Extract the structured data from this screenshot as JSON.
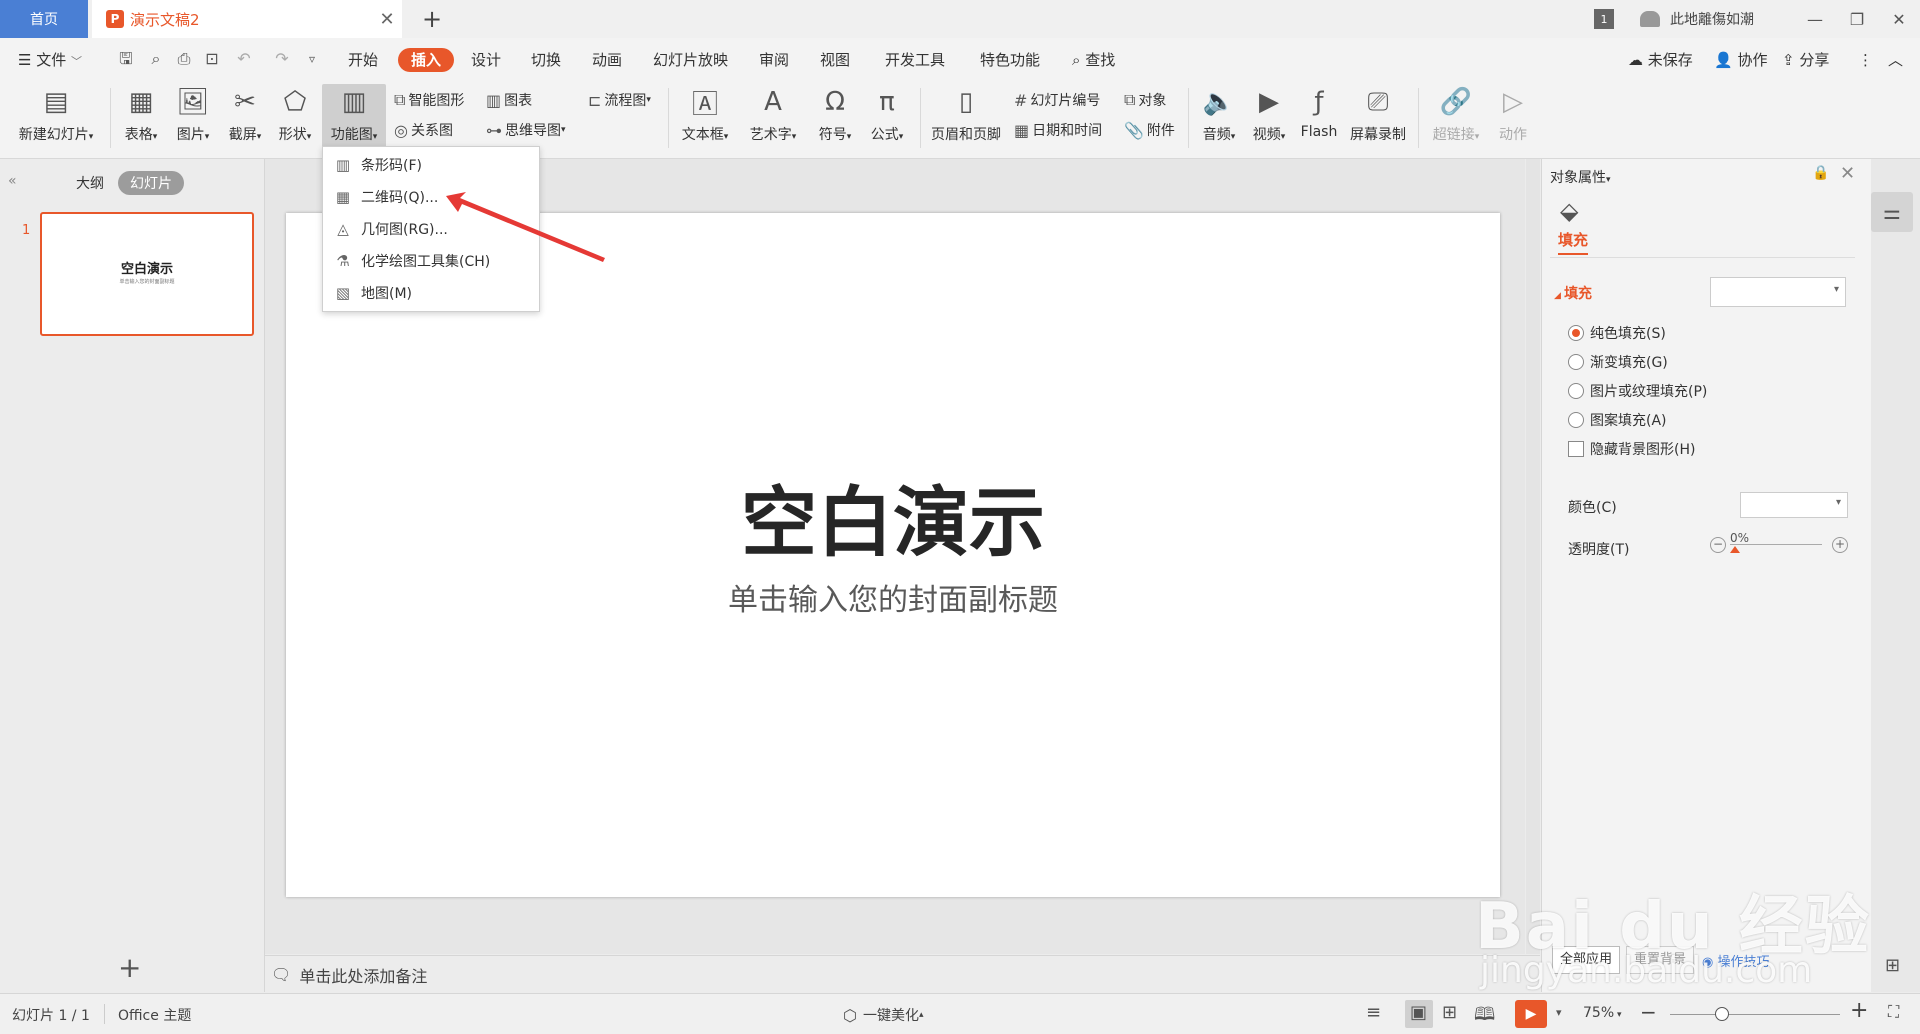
{
  "window": {
    "home_tab": "首页",
    "doc_tab": "演示文稿2",
    "doc_icon_glyph": "P",
    "new_tab_glyph": "+",
    "user_badge": "1",
    "user_name": "此地離傷如潮"
  },
  "menu": {
    "file": "文件",
    "tabs": [
      "开始",
      "插入",
      "设计",
      "切换",
      "动画",
      "幻灯片放映",
      "审阅",
      "视图",
      "开发工具",
      "特色功能"
    ],
    "search": "查找",
    "unsaved": "未保存",
    "collab": "协作",
    "share": "分享"
  },
  "ribbon": {
    "new_slide": "新建幻灯片",
    "table": "表格",
    "picture": "图片",
    "screenshot": "截屏",
    "shape": "形状",
    "function_chart": "功能图",
    "smart_graphic": "智能图形",
    "chart": "图表",
    "relation_chart": "关系图",
    "mind_map": "思维导图",
    "flowchart": "流程图",
    "textbox": "文本框",
    "art_text": "艺术字",
    "symbol": "符号",
    "formula": "公式",
    "header_footer": "页眉和页脚",
    "slide_number": "幻灯片编号",
    "object": "对象",
    "datetime": "日期和时间",
    "attachment": "附件",
    "audio": "音频",
    "video": "视频",
    "flash": "Flash",
    "screen_record": "屏幕录制",
    "hyperlink": "超链接",
    "action": "动作"
  },
  "dropdown": {
    "items": [
      {
        "label": "条形码(F)",
        "icon": "barcode-icon"
      },
      {
        "label": "二维码(Q)...",
        "icon": "qrcode-icon"
      },
      {
        "label": "几何图(RG)...",
        "icon": "geometry-icon"
      },
      {
        "label": "化学绘图工具集(CH)",
        "icon": "flask-icon"
      },
      {
        "label": "地图(M)",
        "icon": "map-icon"
      }
    ]
  },
  "left_panel": {
    "tab_outline": "大纲",
    "tab_slides": "幻灯片",
    "slide_number": "1",
    "thumb_title": "空白演示",
    "thumb_subtitle": "单击输入您的封面副标题"
  },
  "slide": {
    "title": "空白演示",
    "subtitle": "单击输入您的封面副标题"
  },
  "notes": {
    "placeholder": "单击此处添加备注"
  },
  "right_panel": {
    "title": "对象属性",
    "fill_tab": "填充",
    "fill_section": "填充",
    "options": [
      {
        "label": "纯色填充(S)",
        "type": "radio",
        "checked": true
      },
      {
        "label": "渐变填充(G)",
        "type": "radio",
        "checked": false
      },
      {
        "label": "图片或纹理填充(P)",
        "type": "radio",
        "checked": false
      },
      {
        "label": "图案填充(A)",
        "type": "radio",
        "checked": false
      },
      {
        "label": "隐藏背景图形(H)",
        "type": "checkbox",
        "checked": false
      }
    ],
    "color_label": "颜色(C)",
    "transparency_label": "透明度(T)",
    "transparency_value": "0%",
    "apply_all": "全部应用",
    "reset_bg": "重置背景",
    "op_tips": "操作技巧"
  },
  "status": {
    "slide_info": "幻灯片 1 / 1",
    "theme": "Office 主题",
    "beautify": "一键美化",
    "zoom": "75%",
    "zoom_fraction": 0.3
  },
  "watermark": {
    "text": "Bai du 经验",
    "url": "jingyan.baidu.com"
  },
  "colors": {
    "accent": "#e8572a",
    "home_tab": "#4a7fd4"
  }
}
